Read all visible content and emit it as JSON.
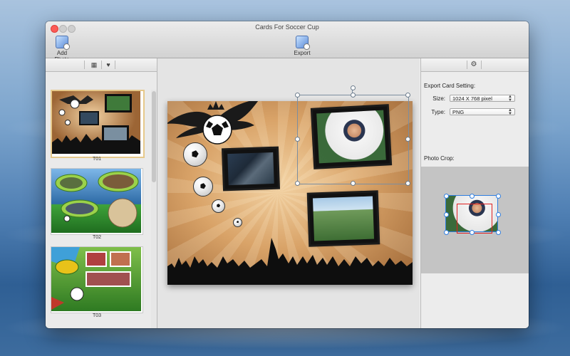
{
  "window": {
    "title": "Cards For Soccer Cup"
  },
  "toolbar": {
    "add_photo_label": "Add Photo",
    "export_label": "Export"
  },
  "left_panel": {
    "tabs": [
      {
        "icon": "grid-icon",
        "glyph": "▦"
      },
      {
        "icon": "heart-icon",
        "glyph": "♥"
      }
    ],
    "templates": [
      {
        "label": "T01",
        "selected": true
      },
      {
        "label": "T02",
        "selected": false
      },
      {
        "label": "T03",
        "selected": false
      }
    ]
  },
  "right_panel": {
    "settings_icon": "gear-icon",
    "export_title": "Export Card Setting:",
    "size_label": "Size:",
    "size_value": "1024 X 768 pixel",
    "type_label": "Type:",
    "type_value": "PNG",
    "crop_title": "Photo Crop:"
  },
  "colors": {
    "selection_border": "#e6c88a",
    "crop_handle": "#2f7ee0",
    "crop_rect": "#e02020"
  }
}
